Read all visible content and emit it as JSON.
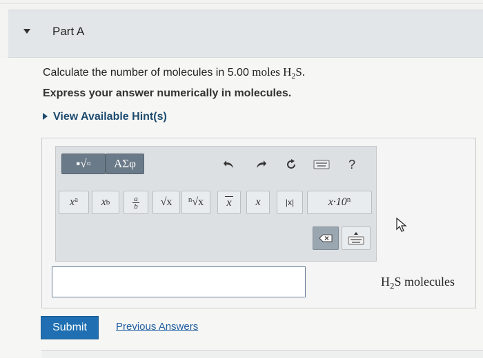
{
  "part": {
    "title": "Part A"
  },
  "question": {
    "line1_prefix": "Calculate the number of molecules in 5.00 ",
    "line1_unit": "moles ",
    "line1_formula_main": "H",
    "line1_formula_sub": "2",
    "line1_formula_end": "S.",
    "line2": "Express your answer numerically in molecules."
  },
  "hint": {
    "label": "View Available Hint(s)"
  },
  "toolbar": {
    "templates_label": "▪√▫",
    "greek_label": "ΑΣφ",
    "undo_icon": "undo-icon",
    "redo_icon": "redo-icon",
    "reset_icon": "reset-icon",
    "keyboard_icon": "keyboard-icon",
    "help_label": "?",
    "row2": {
      "power": "x",
      "power_sup": "a",
      "subscript": "x",
      "subscript_sub": "b",
      "fraction_num": "a",
      "fraction_den": "b",
      "sqrt": "√x",
      "nthroot_n": "n",
      "nthroot": "√x",
      "vector": "x",
      "hat": "x",
      "abs": "|x|",
      "sci": "x·10",
      "sci_sup": "n"
    },
    "delete_icon": "backspace-icon",
    "keypad_icon": "keypad-toggle-icon"
  },
  "answer": {
    "value": "",
    "units_main": "H",
    "units_sub": "2",
    "units_end": "S molecules"
  },
  "actions": {
    "submit": "Submit",
    "previous": "Previous Answers"
  }
}
